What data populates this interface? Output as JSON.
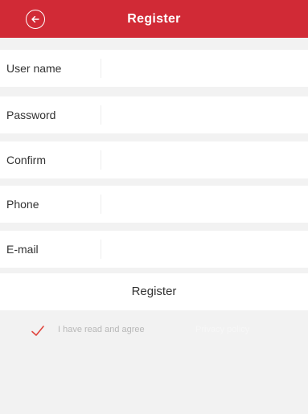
{
  "header": {
    "title": "Register",
    "back_icon": "back-arrow-circle-icon"
  },
  "fields": [
    {
      "label": "User name",
      "value": ""
    },
    {
      "label": "Password",
      "value": ""
    },
    {
      "label": "Confirm",
      "value": ""
    },
    {
      "label": "Phone",
      "value": ""
    },
    {
      "label": "E-mail",
      "value": ""
    }
  ],
  "register_button": {
    "label": "Register"
  },
  "agreement": {
    "checked": true,
    "check_icon": "checkmark-icon",
    "text": "I have read and agree",
    "link": "Privacy policy"
  },
  "colors": {
    "header_bg": "#d12a36",
    "check_mark": "#e0463f",
    "page_bg": "#f2f2f2"
  }
}
